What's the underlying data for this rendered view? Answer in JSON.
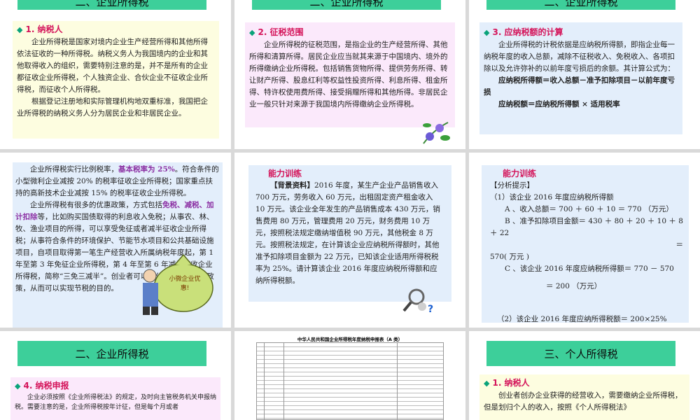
{
  "s1": {
    "header": "二、企业所得税",
    "title": "1. 纳税人",
    "p1": "企业所得税是国家对境内企业生产经营所得和其他所得依法征收的一种所得税。纳税义务人为我国境内的企业和其他取得收入的组织，需要特别注意的是，并不是所有的企业都征收企业所得税，个人独资企业、合伙企业不征收企业所得税，而征收个人所得税。",
    "p2": "根据登记注册地和实际管理机构地双重标准，我国把企业所得税的纳税义务人分为居民企业和非居民企业。"
  },
  "s2": {
    "header": "二、企业所得税",
    "title": "2. 征税范围",
    "p1": "企业所得税的征税范围，是指企业的生产经营所得、其他所得和清算所得。居民企业应当就其来源于中国境内、境外的所得缴纳企业所得税。包括销售货物所得、提供劳务所得、转让财产所得、股息红利等权益性投资所得、利息所得、租金所得、特许权使用费所得、接受捐赠所得和其他所得。非居民企业一般只针对来源于我国境内所得缴纳企业所得税。"
  },
  "s3": {
    "header": "二、企业所得税",
    "title": "3. 应纳税额的计算",
    "p1": "企业所得税的计税依据是应纳税所得额，即指企业每一纳税年度的收入总额，减除不征税收入、免税收入、各项扣除以及允许弥补的以前年度亏损后的余额。其计算公式为：",
    "f1": "应纳税所得额＝收入总额－准予扣除项目－以前年度亏损",
    "f2": "应纳税额＝应纳税所得额 × 适用税率"
  },
  "s4": {
    "p1a": "企业所得税实行比例税率，",
    "p1b": "基本税率为 25%",
    "p1c": "。符合条件的小型微利企业减按 20% 的税率征收企业所得税；国家重点扶持的高新技术企业减按 15% 的税率征收企业所得税。",
    "p2a": "企业所得税有很多的优惠政策，方式包括",
    "p2b": "免税、减税、加计扣除",
    "p2c": "等，比如购买国债取得的利息收入免税；从事农、林、牧、渔业项目的所得，可以享受免征或者减半征收企业所得税；从事符合条件的环境保护、节能节水项目和公共基础设施项目，自项目取得第一笔生产经营收入所属纳税年度起，第 1 年至第 3 年免征企业所得税，第 4 年至第 6 年减半征收企业所得税，简称“三免三减半”。创业者可以充分利用税收优惠政策，从而可以实现节税的目的。",
    "bag_label": "小微企业优惠!"
  },
  "s5": {
    "title": "能力训练",
    "p1a": "【背景资料】",
    "p1b": "2016 年度，某生产企业产品销售收入 700 万元，劳务收入 60 万元，出租固定资产租金收入 10 万元。该企业全年发生的产品销售成本 430 万元，销售费用 80 万元，管理费用 20 万元，财务费用 10 万元，按照税法规定缴纳增值税 90 万元，其他税金 8 万元。按照税法规定，在计算该企业应纳税所得额时，其他准予扣除项目金额为 22 万元，已知该企业适用所得税税率为 25%。请计算该企业 2016 年度应纳税所得额和应纳所得税额。"
  },
  "s6": {
    "title": "能力训练",
    "hint": "【分析提示】",
    "l1": "（1）该企业 2016 年度应纳税所得额",
    "l2": "A 、收入总额＝ 700 ＋ 60 ＋ 10 ＝ 770 （万元）",
    "l3": "B 、准予扣除项目金额＝ 430 ＋ 80 ＋ 20 ＋ 10 ＋ 8 ＋ 22",
    "l3b": "＝",
    "l4": "570( 万元 )",
    "l5": "C 、该企业 2016 年度应纳税所得额＝ 770 － 570",
    "l6": "＝ 200 （万元）",
    "l7": "（2）该企业 2016 年度应纳所得税额＝ 200×25%"
  },
  "s7": {
    "header": "二、企业所得税",
    "title": "4. 纳税申报",
    "p1": "企业必须按照《企业所得税法》的规定，及时向主管税务机关申报纳税。需要注意的是，企业所得税按年计征，但是每个月或者"
  },
  "s8": {
    "form_title": "中华人民共和国企业所得税年度纳税申报表（A 类）"
  },
  "s9": {
    "header": "三、个人所得税",
    "title": "1. 纳税人",
    "p1": "创业者创办企业获得的经营收入，需要缴纳企业所得税，但是划归个人的收入，按照《个人所得税法》"
  }
}
